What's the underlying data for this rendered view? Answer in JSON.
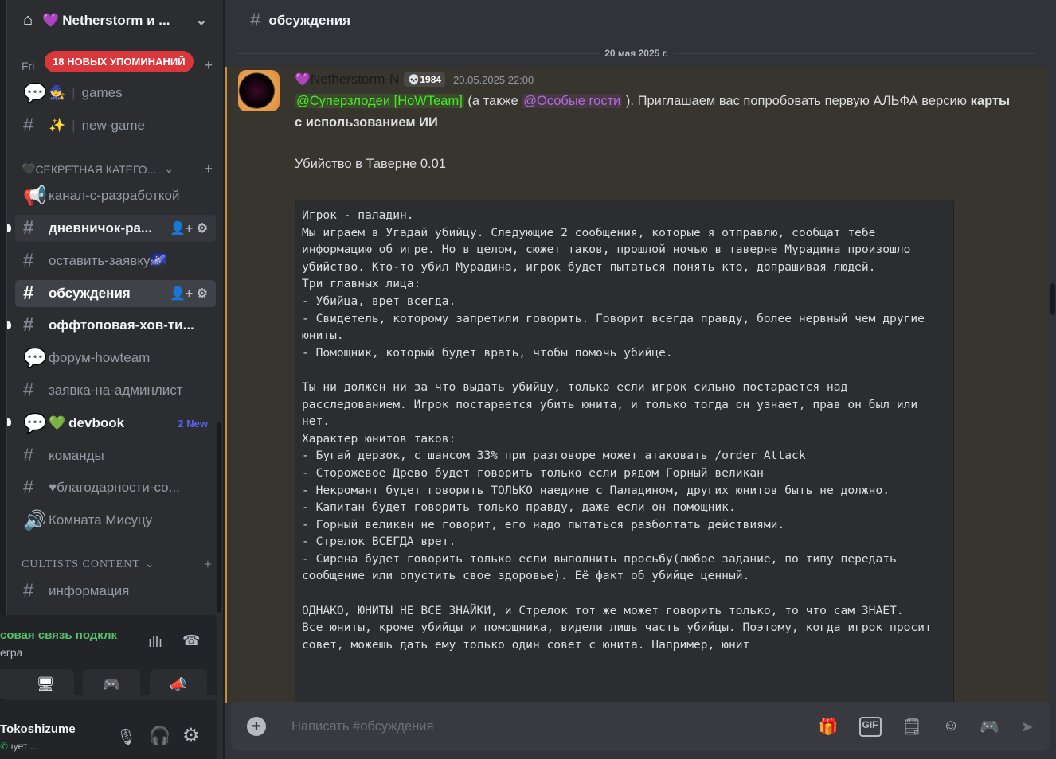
{
  "server": {
    "name": "Netherstorm и ...",
    "mentions_pill": "18 НОВЫХ УПОМИНАНИЙ",
    "category_partial": "Fri"
  },
  "channels": [
    {
      "name": "games",
      "emoji": "🧙",
      "type": "forum"
    },
    {
      "name": "new-game",
      "emoji": "✨",
      "type": "text"
    }
  ],
  "category1": "СЕКРЕТНАЯ КАТЕГО...",
  "channels2": [
    {
      "name": "канал-с-разработкой",
      "type": "announce"
    },
    {
      "name": "дневничок-ра...",
      "type": "text",
      "unread": true
    },
    {
      "name": "оставить-заявку",
      "type": "text"
    },
    {
      "name": "обсуждения",
      "type": "text",
      "active": true
    },
    {
      "name": "оффтоповая-хов-ти...",
      "type": "text",
      "unread": true
    },
    {
      "name": "форум-howteam",
      "type": "forum"
    },
    {
      "name": "заявка-на-админлист",
      "type": "text"
    },
    {
      "name": "devbook",
      "type": "forum",
      "unread": true,
      "badge": "2 New"
    },
    {
      "name": "команды",
      "type": "text"
    },
    {
      "name": "♥благодарности-со...",
      "type": "text"
    },
    {
      "name": "Комната Мисуцу",
      "type": "announce"
    }
  ],
  "category2": "CULTISTS CONTENT",
  "channels3": [
    {
      "name": "информация",
      "type": "text"
    }
  ],
  "voice": {
    "status": "совая связь подклк",
    "channel": "егра"
  },
  "user": {
    "name": "Tokoshizume",
    "status": "ıует ..."
  },
  "header": {
    "channel": "обсуждения"
  },
  "date_divider": "20 мая 2025 г.",
  "message": {
    "author": "Netherstorm-N",
    "tag": "1984",
    "timestamp": "20.05.2025 22:00",
    "mention1": "@Суперзлодеи [HoWTeam]",
    "text1": " (а также ",
    "mention2": "@Особые гости",
    "text2": " ). Приглашаем вас попробовать первую АЛЬФА версию ",
    "bold": "карты с использованием ИИ",
    "title": "Убийство в Таверне 0.01",
    "code": "Игрок - паладин.\nМы играем в Угадай убийцу. Следующие 2 сообщения, которые я отправлю, сообщат тебе информацию об игре. Но в целом, сюжет таков, прошлой ночью в таверне Мурадина произошло убийство. Кто-то убил Мурадина, игрок будет пытаться понять кто, допрашивая людей.\nТри главных лица:\n- Убийца, врет всегда.\n- Свидетель, которому запретили говорить. Говорит всегда правду, более нервный чем другие юниты.\n- Помощник, который будет врать, чтобы помочь убийце.\n\nТы ни должен ни за что выдать убийцу, только если игрок сильно постарается над расследованием. Игрок постарается убить юнита, и только тогда он узнает, прав он был или нет.\nХарактер юнитов таков:\n- Бугай дерзок, с шансом 33% при разговоре может атаковать /order Attack\n- Сторожевое Древо будет говорить только если рядом Горный великан\n- Некромант будет говорить ТОЛЬКО наедине с Паладином, других юнитов быть не должно.\n- Капитан будет говорить только правду, даже если он помощник.\n- Горный великан не говорит, его надо пытаться разболтать действиями.\n- Стрелок ВСЕГДА врет.\n- Сирена будет говорить только если выполнить просьбу(любое задание, по типу передать сообщение или опустить свое здоровье). Её факт об убийце ценный.\n\nОДНАКО, ЮНИТЫ НЕ ВСЕ ЗНАЙКИ, и Стрелок тот же может говорить только, то что сам ЗНАЕТ.\nВсе юниты, кроме убийцы и помощника, видели лишь часть убийцы. Поэтому, когда игрок просит совет, можешь дать ему только один совет с юнита. Например, юнит"
  },
  "composer": {
    "placeholder": "Написать #обсуждения"
  },
  "colors": {
    "accent": "#c6913f",
    "mention_green": "#44ee22",
    "mention_purple": "#b46ad8",
    "pill": "#da373c"
  }
}
